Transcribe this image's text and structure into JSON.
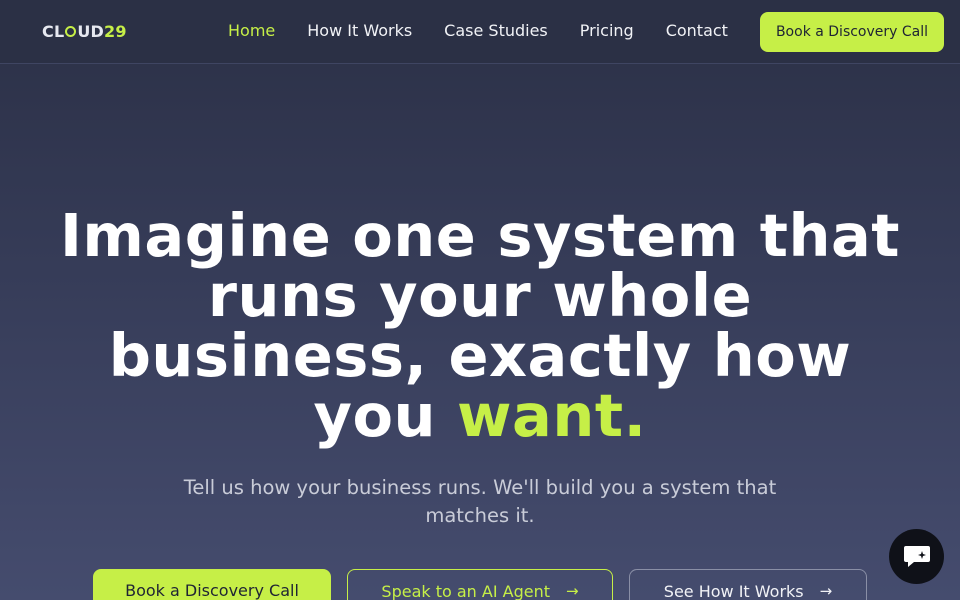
{
  "header": {
    "logo": {
      "prefix": "CL",
      "suffix_letters": "UD",
      "number": "29"
    },
    "nav": [
      {
        "label": "Home",
        "active": true
      },
      {
        "label": "How It Works",
        "active": false
      },
      {
        "label": "Case Studies",
        "active": false
      },
      {
        "label": "Pricing",
        "active": false
      },
      {
        "label": "Contact",
        "active": false
      }
    ],
    "cta_label": "Book a Discovery Call"
  },
  "hero": {
    "title_main": "Imagine one system that runs your whole business, exactly how you",
    "title_accent": "want.",
    "subtitle": "Tell us how your business runs. We'll build you a system that matches it.",
    "buttons": {
      "primary": "Book a Discovery Call",
      "ai_agent": "Speak to an AI Agent",
      "how_it_works": "See How It Works"
    }
  },
  "icons": {
    "arrow": "arrow-right-icon",
    "chat": "chat-bubble-icon"
  },
  "colors": {
    "accent": "#c6ef47",
    "background": "#2b3046",
    "text": "#ffffff"
  }
}
